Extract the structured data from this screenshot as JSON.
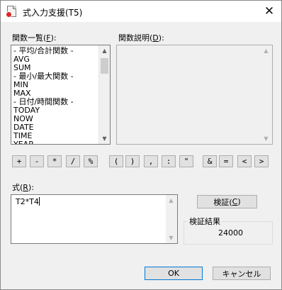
{
  "window": {
    "title": "式入力支援(T5)"
  },
  "icons": {
    "app": "document-app-icon",
    "close": "close-icon"
  },
  "functions_label": {
    "before": "関数一覧(",
    "key": "F",
    "after": "):"
  },
  "description_label": {
    "before": "関数説明(",
    "key": "D",
    "after": "):"
  },
  "function_list": [
    "- 平均/合計関数 -",
    "AVG",
    "SUM",
    "- 最小/最大関数 -",
    "MIN",
    "MAX",
    "- 日付/時間関数 -",
    "TODAY",
    "NOW",
    "DATE",
    "TIME",
    "YEAR"
  ],
  "operators": [
    "+",
    "-",
    "*",
    "/",
    "%",
    "(",
    ")",
    ",",
    ":",
    "\"",
    "&",
    "=",
    "<",
    ">"
  ],
  "formula_label": {
    "before": "式(",
    "key": "R",
    "after": "):"
  },
  "formula_value": "T2*T4",
  "verify_button": {
    "before": "検証(",
    "key": "C",
    "after": ")"
  },
  "result_group_label": "検証結果",
  "result_value": "24000",
  "ok_label": "OK",
  "cancel_label": "キャンセル",
  "scroll_arrows": {
    "up": "▲",
    "down": "▼"
  }
}
